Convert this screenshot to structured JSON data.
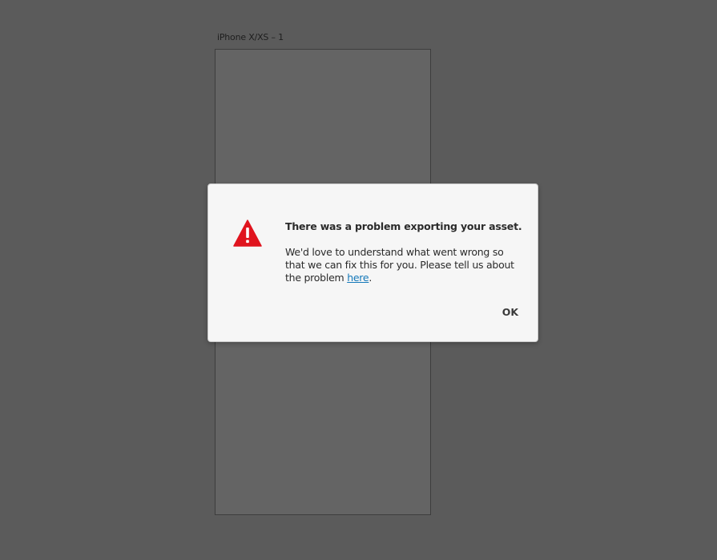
{
  "artboard": {
    "label": "iPhone X/XS – 1"
  },
  "dialog": {
    "icon": "warning-triangle-icon",
    "icon_color": "#e0141e",
    "title": "There was a problem exporting your asset.",
    "message_before": "We'd love to understand what went wrong so that we can fix this for you. Please tell us about the problem ",
    "link_text": "here",
    "message_after": ".",
    "ok_label": "OK"
  }
}
